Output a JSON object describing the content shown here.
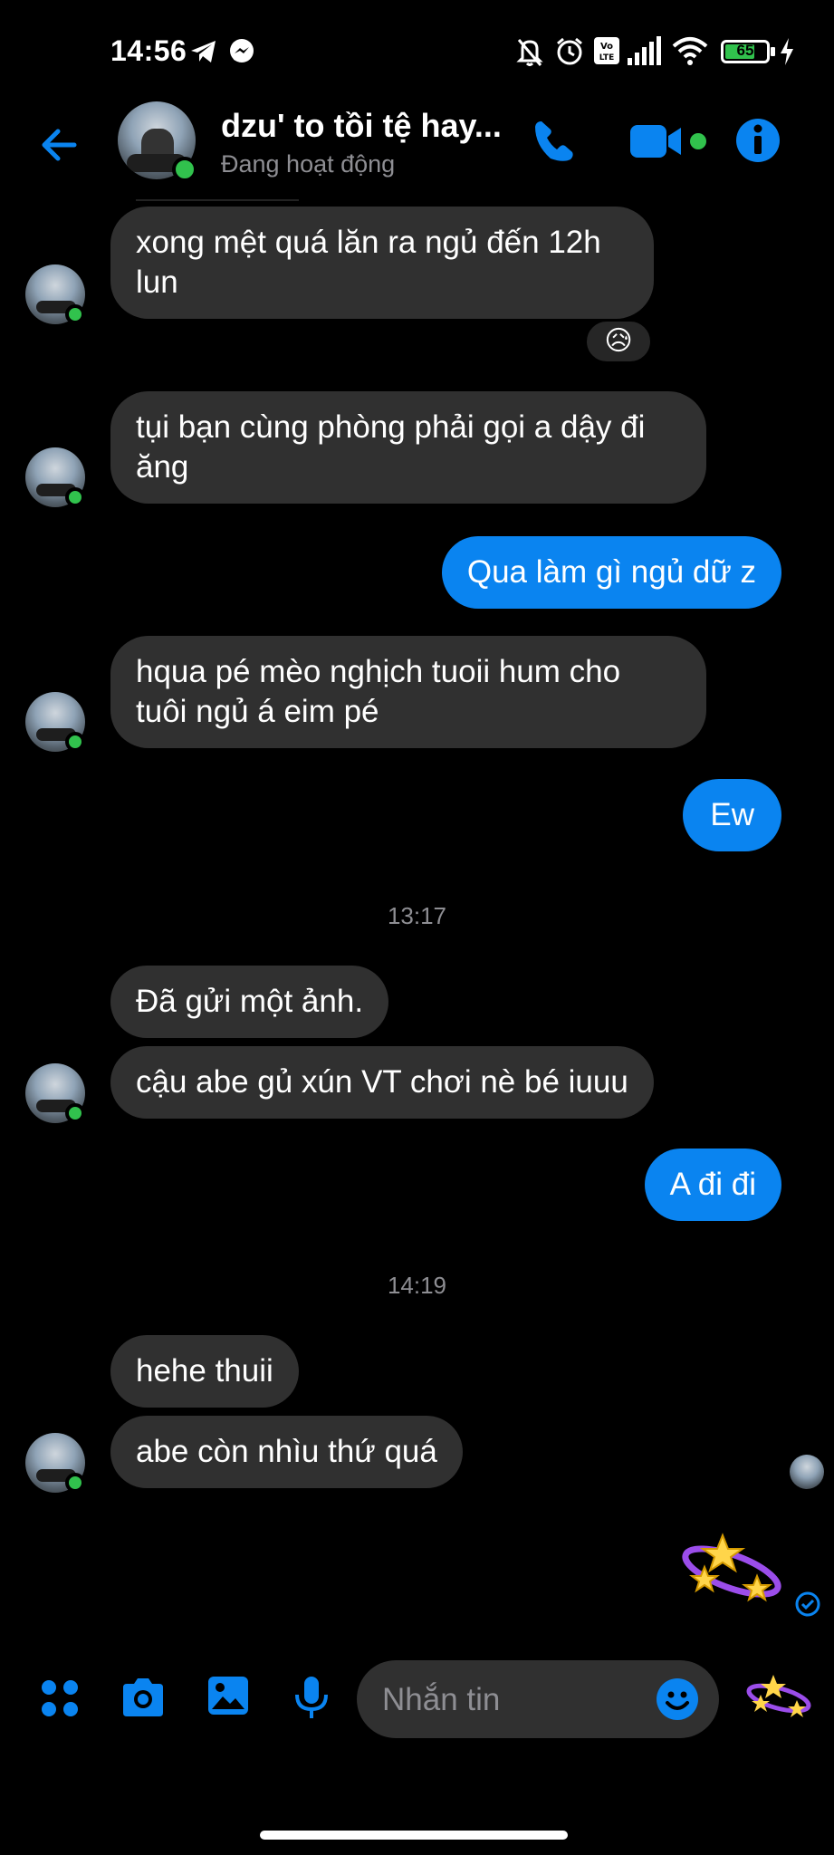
{
  "status_bar": {
    "time": "14:56",
    "battery": "65"
  },
  "header": {
    "contact_name": "dzu' to tồi tệ hay...",
    "contact_status": "Đang hoạt động"
  },
  "messages": {
    "m1": [
      "xong mệt quá lăn ra ngủ đến 12h",
      "lun"
    ],
    "m1_reaction": "😥",
    "m2": [
      "tụi bạn cùng phòng phải gọi a dậy đi",
      "ăng"
    ],
    "m3": "Qua làm gì ngủ dữ z",
    "m4": [
      "hqua pé mèo nghịch tuoii hum cho",
      "tuôi ngủ á eim pé"
    ],
    "m5": "Ew",
    "t1": "13:17",
    "m6": "Đã gửi một ảnh.",
    "m7": "cậu abe gủ xún VT chơi nè bé iuuu",
    "m8": "A đi đi",
    "t2": "14:19",
    "m9": "hehe thuii",
    "m10": "abe còn nhìu thứ quá"
  },
  "composer": {
    "placeholder": "Nhắn tin"
  },
  "colors": {
    "accent": "#0a84f0",
    "incoming_bubble": "#303030",
    "online": "#31c24d",
    "background": "#000000"
  },
  "icons": [
    "telegram-icon",
    "messenger-icon",
    "bell-off-icon",
    "alarm-icon",
    "volte-icon",
    "signal-icon",
    "wifi-icon",
    "battery-icon",
    "charging-icon",
    "back-arrow-icon",
    "phone-icon",
    "video-icon",
    "info-icon",
    "apps-icon",
    "camera-icon",
    "gallery-icon",
    "mic-icon",
    "emoji-icon",
    "sticker-icon",
    "seen-check-icon"
  ]
}
